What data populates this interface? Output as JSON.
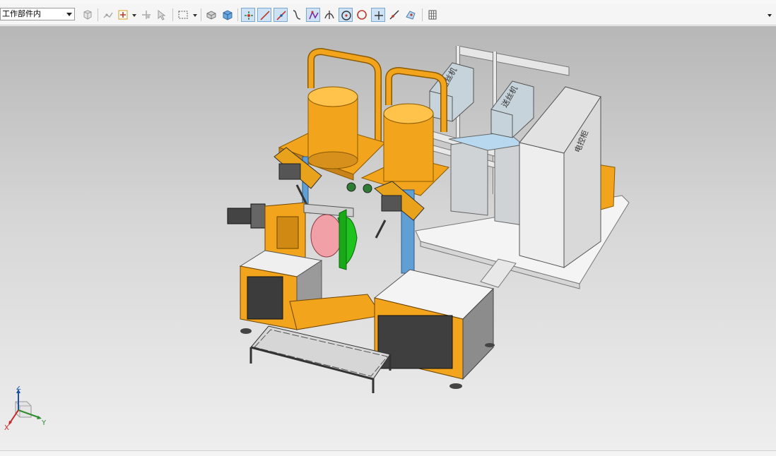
{
  "toolbar": {
    "selection_filter": {
      "value": "工作部件内"
    },
    "buttons": [
      {
        "name": "assembly-filter-button",
        "icon": "assembly-filter-icon",
        "active": false
      },
      {
        "name": "snap-point-button",
        "icon": "snap-point-icon",
        "active": false
      },
      {
        "name": "add-point-button",
        "icon": "add-point-icon",
        "active": false
      },
      {
        "name": "point-constructor-button",
        "icon": "point-constructor-icon",
        "active": false
      },
      {
        "name": "select-tool-button",
        "icon": "select-tool-icon",
        "active": false
      },
      {
        "name": "rectangle-select-button",
        "icon": "rectangle-select-icon",
        "active": false
      },
      {
        "name": "shaded-view-button",
        "icon": "shaded-view-icon",
        "active": false
      },
      {
        "name": "solid-view-button",
        "icon": "solid-view-icon",
        "active": false
      },
      {
        "name": "snap-endpoint-button",
        "icon": "snap-endpoint-icon",
        "active": true
      },
      {
        "name": "snap-line-button",
        "icon": "snap-line-icon",
        "active": true
      },
      {
        "name": "snap-midpoint-button",
        "icon": "snap-midpoint-icon",
        "active": true
      },
      {
        "name": "snap-curve-button",
        "icon": "snap-curve-icon",
        "active": false
      },
      {
        "name": "snap-control-point-button",
        "icon": "snap-control-point-icon",
        "active": true
      },
      {
        "name": "snap-intersection-button",
        "icon": "snap-intersection-icon",
        "active": false
      },
      {
        "name": "snap-arc-center-button",
        "icon": "snap-arc-center-icon",
        "active": true
      },
      {
        "name": "snap-quadrant-button",
        "icon": "snap-quadrant-icon",
        "active": false
      },
      {
        "name": "snap-existing-point-button",
        "icon": "snap-existing-point-icon",
        "active": true
      },
      {
        "name": "snap-point-on-curve-button",
        "icon": "snap-point-on-curve-icon",
        "active": false
      },
      {
        "name": "snap-point-on-surface-button",
        "icon": "snap-point-on-surface-icon",
        "active": false
      },
      {
        "name": "grid-button",
        "icon": "grid-icon",
        "active": false
      }
    ]
  },
  "scene": {
    "cabinet_label": "电控柜",
    "feeder_label_1": "送丝机",
    "feeder_label_2": "送丝机"
  },
  "triad": {
    "z": "Z",
    "y": "Y",
    "x": "X"
  },
  "colors": {
    "frame_orange": "#f2a41c",
    "cabinet_gray": "#d8d8d8",
    "workpiece_green": "#1fc21f",
    "workpiece_pink": "#f2a0a8",
    "column_blue": "#5f9fd3",
    "active_blue": "#cde3f5"
  }
}
